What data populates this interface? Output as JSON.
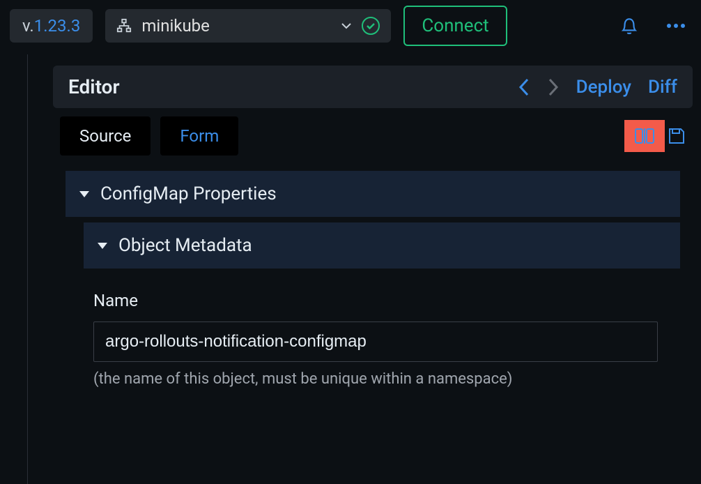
{
  "top": {
    "version_prefix": "v.",
    "version_number": "1.23.3",
    "cluster_name": "minikube",
    "connect_label": "Connect"
  },
  "editor": {
    "title": "Editor",
    "deploy_label": "Deploy",
    "diff_label": "Diff",
    "tabs": {
      "source": "Source",
      "form": "Form"
    }
  },
  "form": {
    "section1_title": "ConfigMap Properties",
    "section2_title": "Object Metadata",
    "name_label": "Name",
    "name_value": "argo-rollouts-notification-configmap",
    "name_help": "(the name of this object, must be unique within a namespace)"
  }
}
